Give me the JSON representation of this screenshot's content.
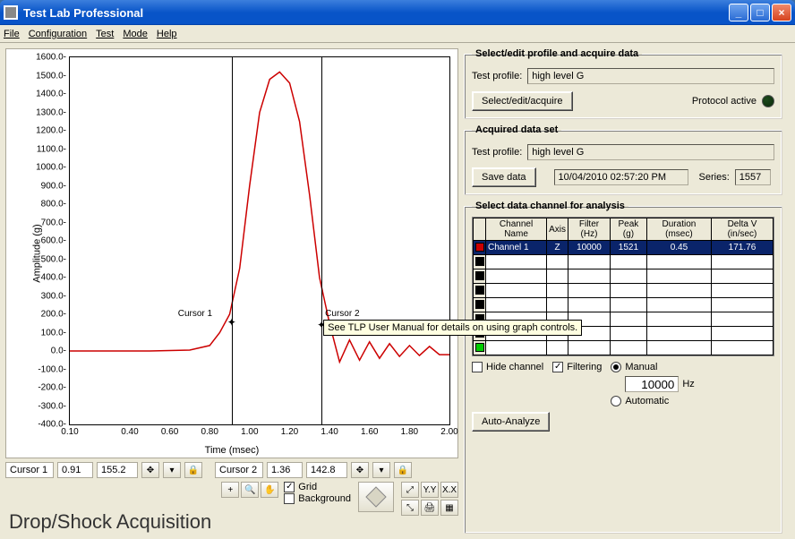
{
  "window": {
    "title": "Test Lab Professional"
  },
  "menubar": [
    "File",
    "Configuration",
    "Test",
    "Mode",
    "Help"
  ],
  "chart_data": {
    "type": "line",
    "xlabel": "Time (msec)",
    "ylabel": "Amplitude (g)",
    "xlim": [
      0.1,
      2.0
    ],
    "ylim": [
      -400.0,
      1600.0
    ],
    "xticks": [
      0.1,
      0.4,
      0.6,
      0.8,
      1.0,
      1.2,
      1.4,
      1.6,
      1.8,
      2.0
    ],
    "yticks": [
      -400.0,
      -300.0,
      -200.0,
      -100.0,
      0.0,
      100.0,
      200.0,
      300.0,
      400.0,
      500.0,
      600.0,
      700.0,
      800.0,
      900.0,
      1000.0,
      1100.0,
      1200.0,
      1300.0,
      1400.0,
      1500.0,
      1600.0
    ],
    "series": [
      {
        "name": "Channel 1",
        "color": "#cc0000",
        "x": [
          0.1,
          0.5,
          0.7,
          0.8,
          0.85,
          0.9,
          0.95,
          1.0,
          1.05,
          1.1,
          1.15,
          1.2,
          1.25,
          1.3,
          1.35,
          1.4,
          1.45,
          1.5,
          1.55,
          1.6,
          1.65,
          1.7,
          1.75,
          1.8,
          1.85,
          1.9,
          1.95,
          2.0
        ],
        "y": [
          0,
          0,
          5,
          30,
          100,
          200,
          450,
          900,
          1300,
          1480,
          1520,
          1460,
          1250,
          850,
          400,
          150,
          -60,
          60,
          -50,
          50,
          -40,
          40,
          -30,
          30,
          -25,
          25,
          -20,
          -20
        ]
      }
    ],
    "cursors": [
      {
        "label": "Cursor 1",
        "x": 0.91,
        "y": 155.2
      },
      {
        "label": "Cursor 2",
        "x": 1.36,
        "y": 142.8
      }
    ],
    "tooltip": "See TLP User Manual for details on using graph controls."
  },
  "cursor_bar": {
    "c1_label": "Cursor 1",
    "c1_x": "0.91",
    "c1_y": "155.2",
    "c2_label": "Cursor 2",
    "c2_x": "1.36",
    "c2_y": "142.8"
  },
  "grid_opts": {
    "grid_label": "Grid",
    "bg_label": "Background",
    "grid_checked": true,
    "bg_checked": false
  },
  "app_mode_label": "Drop/Shock Acquisition",
  "profile_panel": {
    "legend": "Select/edit profile and acquire data",
    "profile_label": "Test profile:",
    "profile_value": "high level G",
    "btn": "Select/edit/acquire",
    "protocol_label": "Protocol active"
  },
  "acquired_panel": {
    "legend": "Acquired data set",
    "profile_label": "Test profile:",
    "profile_value": "high level G",
    "save_btn": "Save data",
    "timestamp": "10/04/2010 02:57:20 PM",
    "series_label": "Series:",
    "series_value": "1557"
  },
  "analysis_panel": {
    "legend": "Select data channel for analysis",
    "headers": [
      "Channel Name",
      "Axis",
      "Filter (Hz)",
      "Peak (g)",
      "Duration (msec)",
      "Delta V (in/sec)"
    ],
    "rows": [
      {
        "name": "Channel 1",
        "axis": "Z",
        "filter": "10000",
        "peak": "1521",
        "duration": "0.45",
        "deltav": "171.76",
        "selected": true
      }
    ],
    "blank_rows": 7,
    "hide_label": "Hide channel",
    "filtering_label": "Filtering",
    "filtering_checked": true,
    "manual_label": "Manual",
    "hz_value": "10000",
    "hz_unit": "Hz",
    "automatic_label": "Automatic",
    "auto_analyze": "Auto-Analyze"
  }
}
